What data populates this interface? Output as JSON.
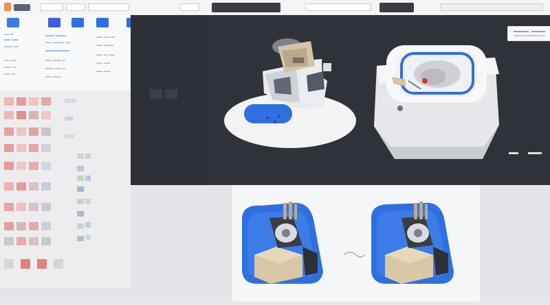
{
  "toolbar": {
    "pills": [
      "",
      "",
      "",
      "",
      ""
    ],
    "accent": "#2f6fe0"
  },
  "palette": {
    "items": [
      {
        "color": "#3a7be8"
      },
      {
        "color": "#3c5ed6"
      },
      {
        "color": "#2f6fe0"
      },
      {
        "color": "#2f6fe0"
      },
      {
        "color": "#2f6fe0"
      }
    ]
  },
  "viewport": {
    "model_left": "3d-machine-part-model",
    "model_right": "3d-enclosure-model"
  },
  "preview": {
    "thumb_left": "machine-thumbnail-left",
    "thumb_right": "machine-thumbnail-right"
  },
  "colors": {
    "dark_bg": "#2e3038",
    "accent_blue": "#2f6fe0",
    "beige": "#d9c7a6"
  }
}
